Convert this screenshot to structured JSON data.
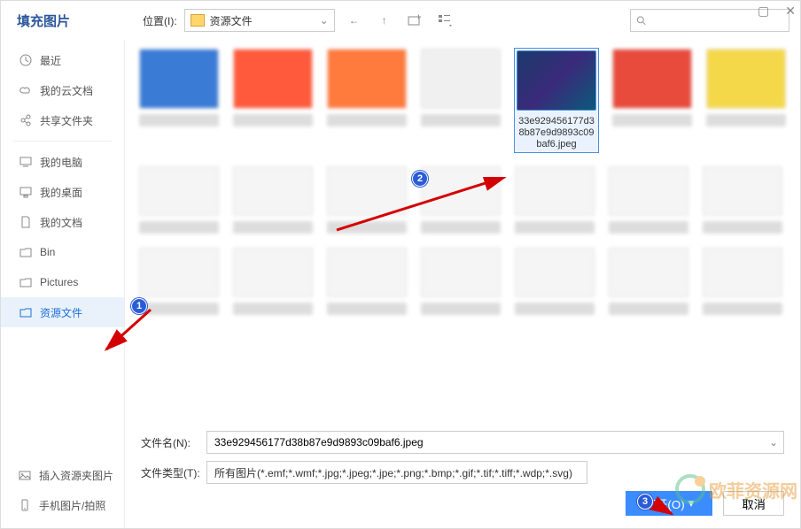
{
  "title": "填充图片",
  "location": {
    "label": "位置(I):",
    "value": "资源文件"
  },
  "windowControls": {
    "min": "▢",
    "close": "✕"
  },
  "sidebar": {
    "recent": "最近",
    "cloud": "我的云文档",
    "shared": "共享文件夹",
    "computer": "我的电脑",
    "desktop": "我的桌面",
    "documents": "我的文档",
    "bin": "Bin",
    "pictures": "Pictures",
    "resources": "资源文件"
  },
  "footerSidebar": {
    "insertFolderImg": "插入资源夹图片",
    "phonePhoto": "手机图片/拍照"
  },
  "selectedFile": {
    "name": "33e929456177d38b87e9d9893c09baf6.jpeg"
  },
  "form": {
    "filenameLabel": "文件名(N):",
    "filenameValue": "33e929456177d38b87e9d9893c09baf6.jpeg",
    "filetypeLabel": "文件类型(T):",
    "filetypeValue": "所有图片(*.emf;*.wmf;*.jpg;*.jpeg;*.jpe;*.png;*.bmp;*.gif;*.tif;*.tiff;*.wdp;*.svg)"
  },
  "buttons": {
    "open": "打开(O)",
    "cancel": "取消"
  },
  "annotations": {
    "a1": "1",
    "a2": "2",
    "a3": "3"
  },
  "watermark": {
    "text": "欧菲资源网",
    "sub": ""
  }
}
